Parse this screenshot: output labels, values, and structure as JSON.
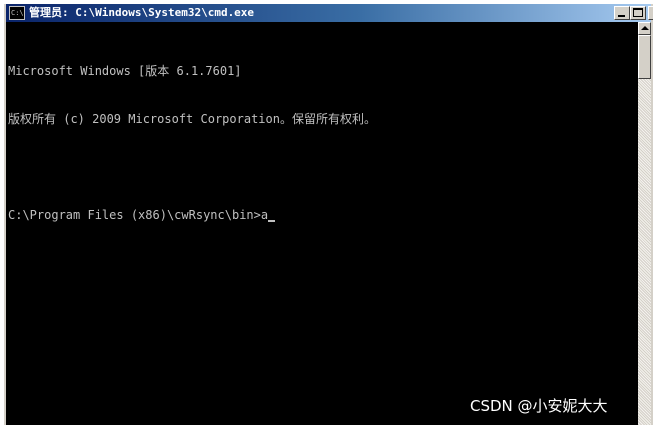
{
  "window": {
    "title": "管理员: C:\\Windows\\System32\\cmd.exe",
    "icon": "cmd-icon",
    "icon_text": "C:\\"
  },
  "console": {
    "lines": [
      "Microsoft Windows [版本 6.1.7601]",
      "版权所有 (c) 2009 Microsoft Corporation。保留所有权利。",
      "",
      "C:\\Program Files (x86)\\cwRsync\\bin>a"
    ]
  },
  "watermark": "CSDN @小安妮大大",
  "colors": {
    "console_bg": "#000000",
    "console_text": "#c0c0c0",
    "titlebar_start": "#0a246a",
    "titlebar_end": "#a6caf0"
  }
}
